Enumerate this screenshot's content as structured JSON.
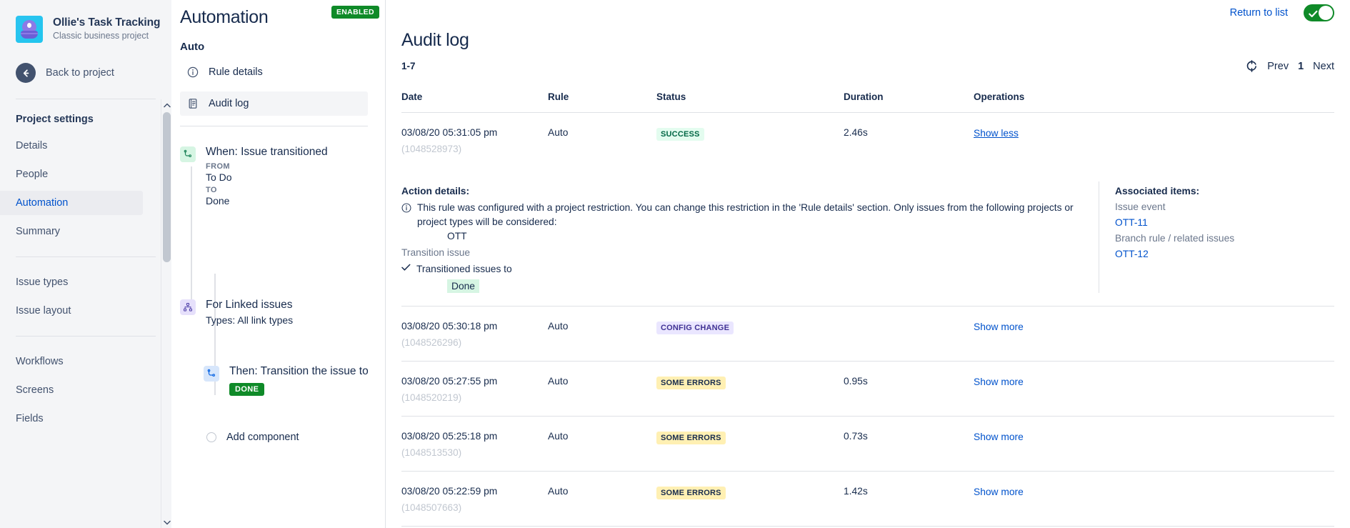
{
  "project": {
    "name": "Ollie's Task Tracking",
    "subtitle": "Classic business project",
    "back_label": "Back to project",
    "avatar_icon": "robot-avatar-icon"
  },
  "sidebar": {
    "section_title": "Project settings",
    "group1": [
      {
        "label": "Details",
        "active": false
      },
      {
        "label": "People",
        "active": false
      },
      {
        "label": "Automation",
        "active": true
      },
      {
        "label": "Summary",
        "active": false
      }
    ],
    "group2": [
      {
        "label": "Issue types"
      },
      {
        "label": "Issue layout"
      }
    ],
    "group3": [
      {
        "label": "Workflows"
      },
      {
        "label": "Screens"
      },
      {
        "label": "Fields"
      }
    ]
  },
  "rule_panel": {
    "title": "Automation",
    "status_badge": "ENABLED",
    "rule_name": "Auto",
    "nav": [
      {
        "label": "Rule details",
        "icon": "info-circle-icon",
        "active": false
      },
      {
        "label": "Audit log",
        "icon": "document-icon",
        "active": true
      }
    ],
    "tree": {
      "trigger": {
        "title": "When: Issue transitioned",
        "from_label": "FROM",
        "from_value": "To Do",
        "to_label": "TO",
        "to_value": "Done",
        "icon": "transition-icon"
      },
      "branch": {
        "title": "For Linked issues",
        "subtitle": "Types: All link types",
        "icon": "branch-icon"
      },
      "action": {
        "title": "Then: Transition the issue to",
        "chip": "DONE",
        "icon": "transition-icon"
      },
      "add_component": "Add component"
    }
  },
  "header": {
    "return_link": "Return to list",
    "toggle_on": true
  },
  "audit": {
    "title": "Audit log",
    "range": "1-7",
    "pager": {
      "refresh_icon": "refresh-icon",
      "prev": "Prev",
      "current": "1",
      "next": "Next"
    },
    "columns": [
      "Date",
      "Rule",
      "Status",
      "Duration",
      "Operations"
    ],
    "rows": [
      {
        "date": "03/08/20 05:31:05 pm",
        "id": "(1048528973)",
        "rule": "Auto",
        "status": "SUCCESS",
        "status_type": "success",
        "duration": "2.46s",
        "operation": "Show less",
        "expanded": true
      },
      {
        "date": "03/08/20 05:30:18 pm",
        "id": "(1048526296)",
        "rule": "Auto",
        "status": "CONFIG CHANGE",
        "status_type": "config",
        "duration": "",
        "operation": "Show more",
        "expanded": false
      },
      {
        "date": "03/08/20 05:27:55 pm",
        "id": "(1048520219)",
        "rule": "Auto",
        "status": "SOME ERRORS",
        "status_type": "errors",
        "duration": "0.95s",
        "operation": "Show more",
        "expanded": false
      },
      {
        "date": "03/08/20 05:25:18 pm",
        "id": "(1048513530)",
        "rule": "Auto",
        "status": "SOME ERRORS",
        "status_type": "errors",
        "duration": "0.73s",
        "operation": "Show more",
        "expanded": false
      },
      {
        "date": "03/08/20 05:22:59 pm",
        "id": "(1048507663)",
        "rule": "Auto",
        "status": "SOME ERRORS",
        "status_type": "errors",
        "duration": "1.42s",
        "operation": "Show more",
        "expanded": false
      }
    ],
    "detail": {
      "action_details_label": "Action details:",
      "restriction_text": "This rule was configured with a project restriction. You can change this restriction in the 'Rule details' section. Only issues from the following projects or project types will be considered:",
      "project_key": "OTT",
      "transition_issue_label": "Transition issue",
      "transitioned_label": "Transitioned issues to",
      "transitioned_value": "Done",
      "associated_items_label": "Associated items:",
      "associated": [
        {
          "kind": "Issue event",
          "key": "OTT-11"
        },
        {
          "kind": "Branch rule / related issues",
          "key": "OTT-12"
        }
      ]
    }
  },
  "colors": {
    "accent_link": "#0052cc",
    "success_green": "#0f8a28",
    "sidebar_bg": "#f4f5f7",
    "text": "#172b4d"
  }
}
